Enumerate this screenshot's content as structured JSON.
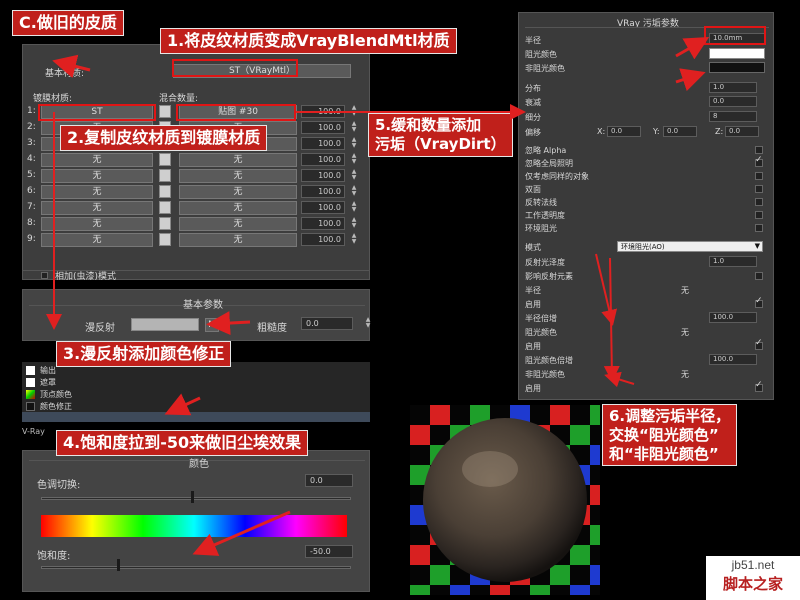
{
  "callouts": {
    "c": "C.做旧的皮质",
    "step1": "1.将皮纹材质变成VrayBlendMtl材质",
    "step2": "2.复制皮纹材质到镀膜材质",
    "step3": "3.漫反射添加颜色修正",
    "step4": "4.饱和度拉到-50来做旧尘埃效果",
    "step5_line1": "5.缓和数量添加",
    "step5_line2": "污垢（VrayDirt）",
    "step6_line1": "6.调整污垢半径，",
    "step6_line2": "交换“阻光颜色”",
    "step6_line3": "和“非阻光颜色”"
  },
  "blend": {
    "base_label": "基本材质:",
    "base_value": "ST（VRayMtl）",
    "coat_label": "镀膜材质:",
    "blend_label": "混合数量:",
    "rows": [
      {
        "num": "1:",
        "coat": "ST",
        "blend": "贴图 #30",
        "amount": "100.0"
      },
      {
        "num": "2:",
        "coat": "无",
        "blend": "无",
        "amount": "100.0"
      },
      {
        "num": "3:",
        "coat": "无",
        "blend": "无",
        "amount": "100.0"
      },
      {
        "num": "4:",
        "coat": "无",
        "blend": "无",
        "amount": "100.0"
      },
      {
        "num": "5:",
        "coat": "无",
        "blend": "无",
        "amount": "100.0"
      },
      {
        "num": "6:",
        "coat": "无",
        "blend": "无",
        "amount": "100.0"
      },
      {
        "num": "7:",
        "coat": "无",
        "blend": "无",
        "amount": "100.0"
      },
      {
        "num": "8:",
        "coat": "无",
        "blend": "无",
        "amount": "100.0"
      },
      {
        "num": "9:",
        "coat": "无",
        "blend": "无",
        "amount": "100.0"
      }
    ],
    "additive_label": "相加(虫漆)模式"
  },
  "basic": {
    "title": "基本参数",
    "diffuse_label": "漫反射",
    "map_btn": "M",
    "rough_label": "粗糙度",
    "rough_value": "0.0"
  },
  "maplist": {
    "items": [
      "输出",
      "遮罩",
      "顶点颜色",
      "颜色修正"
    ],
    "vray_label": "V-Ray"
  },
  "color": {
    "title": "颜色",
    "hue_label": "色调切换:",
    "hue_value": "0.0",
    "sat_label": "饱和度:",
    "sat_value": "-50.0"
  },
  "dirt": {
    "title": "VRay 污垢参数",
    "radius_label": "半径",
    "radius_value": "10.0mm",
    "occ_label": "阻光颜色",
    "unocc_label": "非阻光颜色",
    "dist_label": "分布",
    "dist_value": "1.0",
    "falloff_label": "衰减",
    "falloff_value": "0.0",
    "subdiv_label": "细分",
    "subdiv_value": "8",
    "bias_label": "偏移",
    "bias_x_label": "X:",
    "bias_x": "0.0",
    "bias_y_label": "Y:",
    "bias_y": "0.0",
    "bias_z_label": "Z:",
    "bias_z": "0.0",
    "checks": [
      {
        "label": "忽略 Alpha",
        "on": false
      },
      {
        "label": "忽略全局照明",
        "on": true
      },
      {
        "label": "仅考虑同样的对象",
        "on": false
      },
      {
        "label": "双面",
        "on": false
      },
      {
        "label": "反转法线",
        "on": false
      },
      {
        "label": "工作透明度",
        "on": false
      },
      {
        "label": "环境阻光",
        "on": false
      }
    ],
    "mode_label": "模式",
    "mode_value": "环境阻光(AO)",
    "gloss_label": "反射光泽度",
    "gloss_value": "1.0",
    "affect_label": "影响反射元素",
    "sub_sections": [
      {
        "label": "半径",
        "map": "无"
      },
      {
        "label": "启用",
        "map": ""
      },
      {
        "label": "半径倍增",
        "map": ""
      },
      {
        "label": "阻光颜色",
        "map": "无"
      },
      {
        "label": "启用",
        "map": ""
      },
      {
        "label": "阻光颜色倍增",
        "map": ""
      },
      {
        "label": "非阻光颜色",
        "map": "无"
      },
      {
        "label": "启用",
        "map": ""
      }
    ],
    "mult_value": "100.0"
  },
  "watermark": {
    "site": "jb51.net",
    "name": "脚本之家"
  },
  "colors": {
    "callout_red": "#c0201b",
    "panel": "#3d3d3d"
  }
}
